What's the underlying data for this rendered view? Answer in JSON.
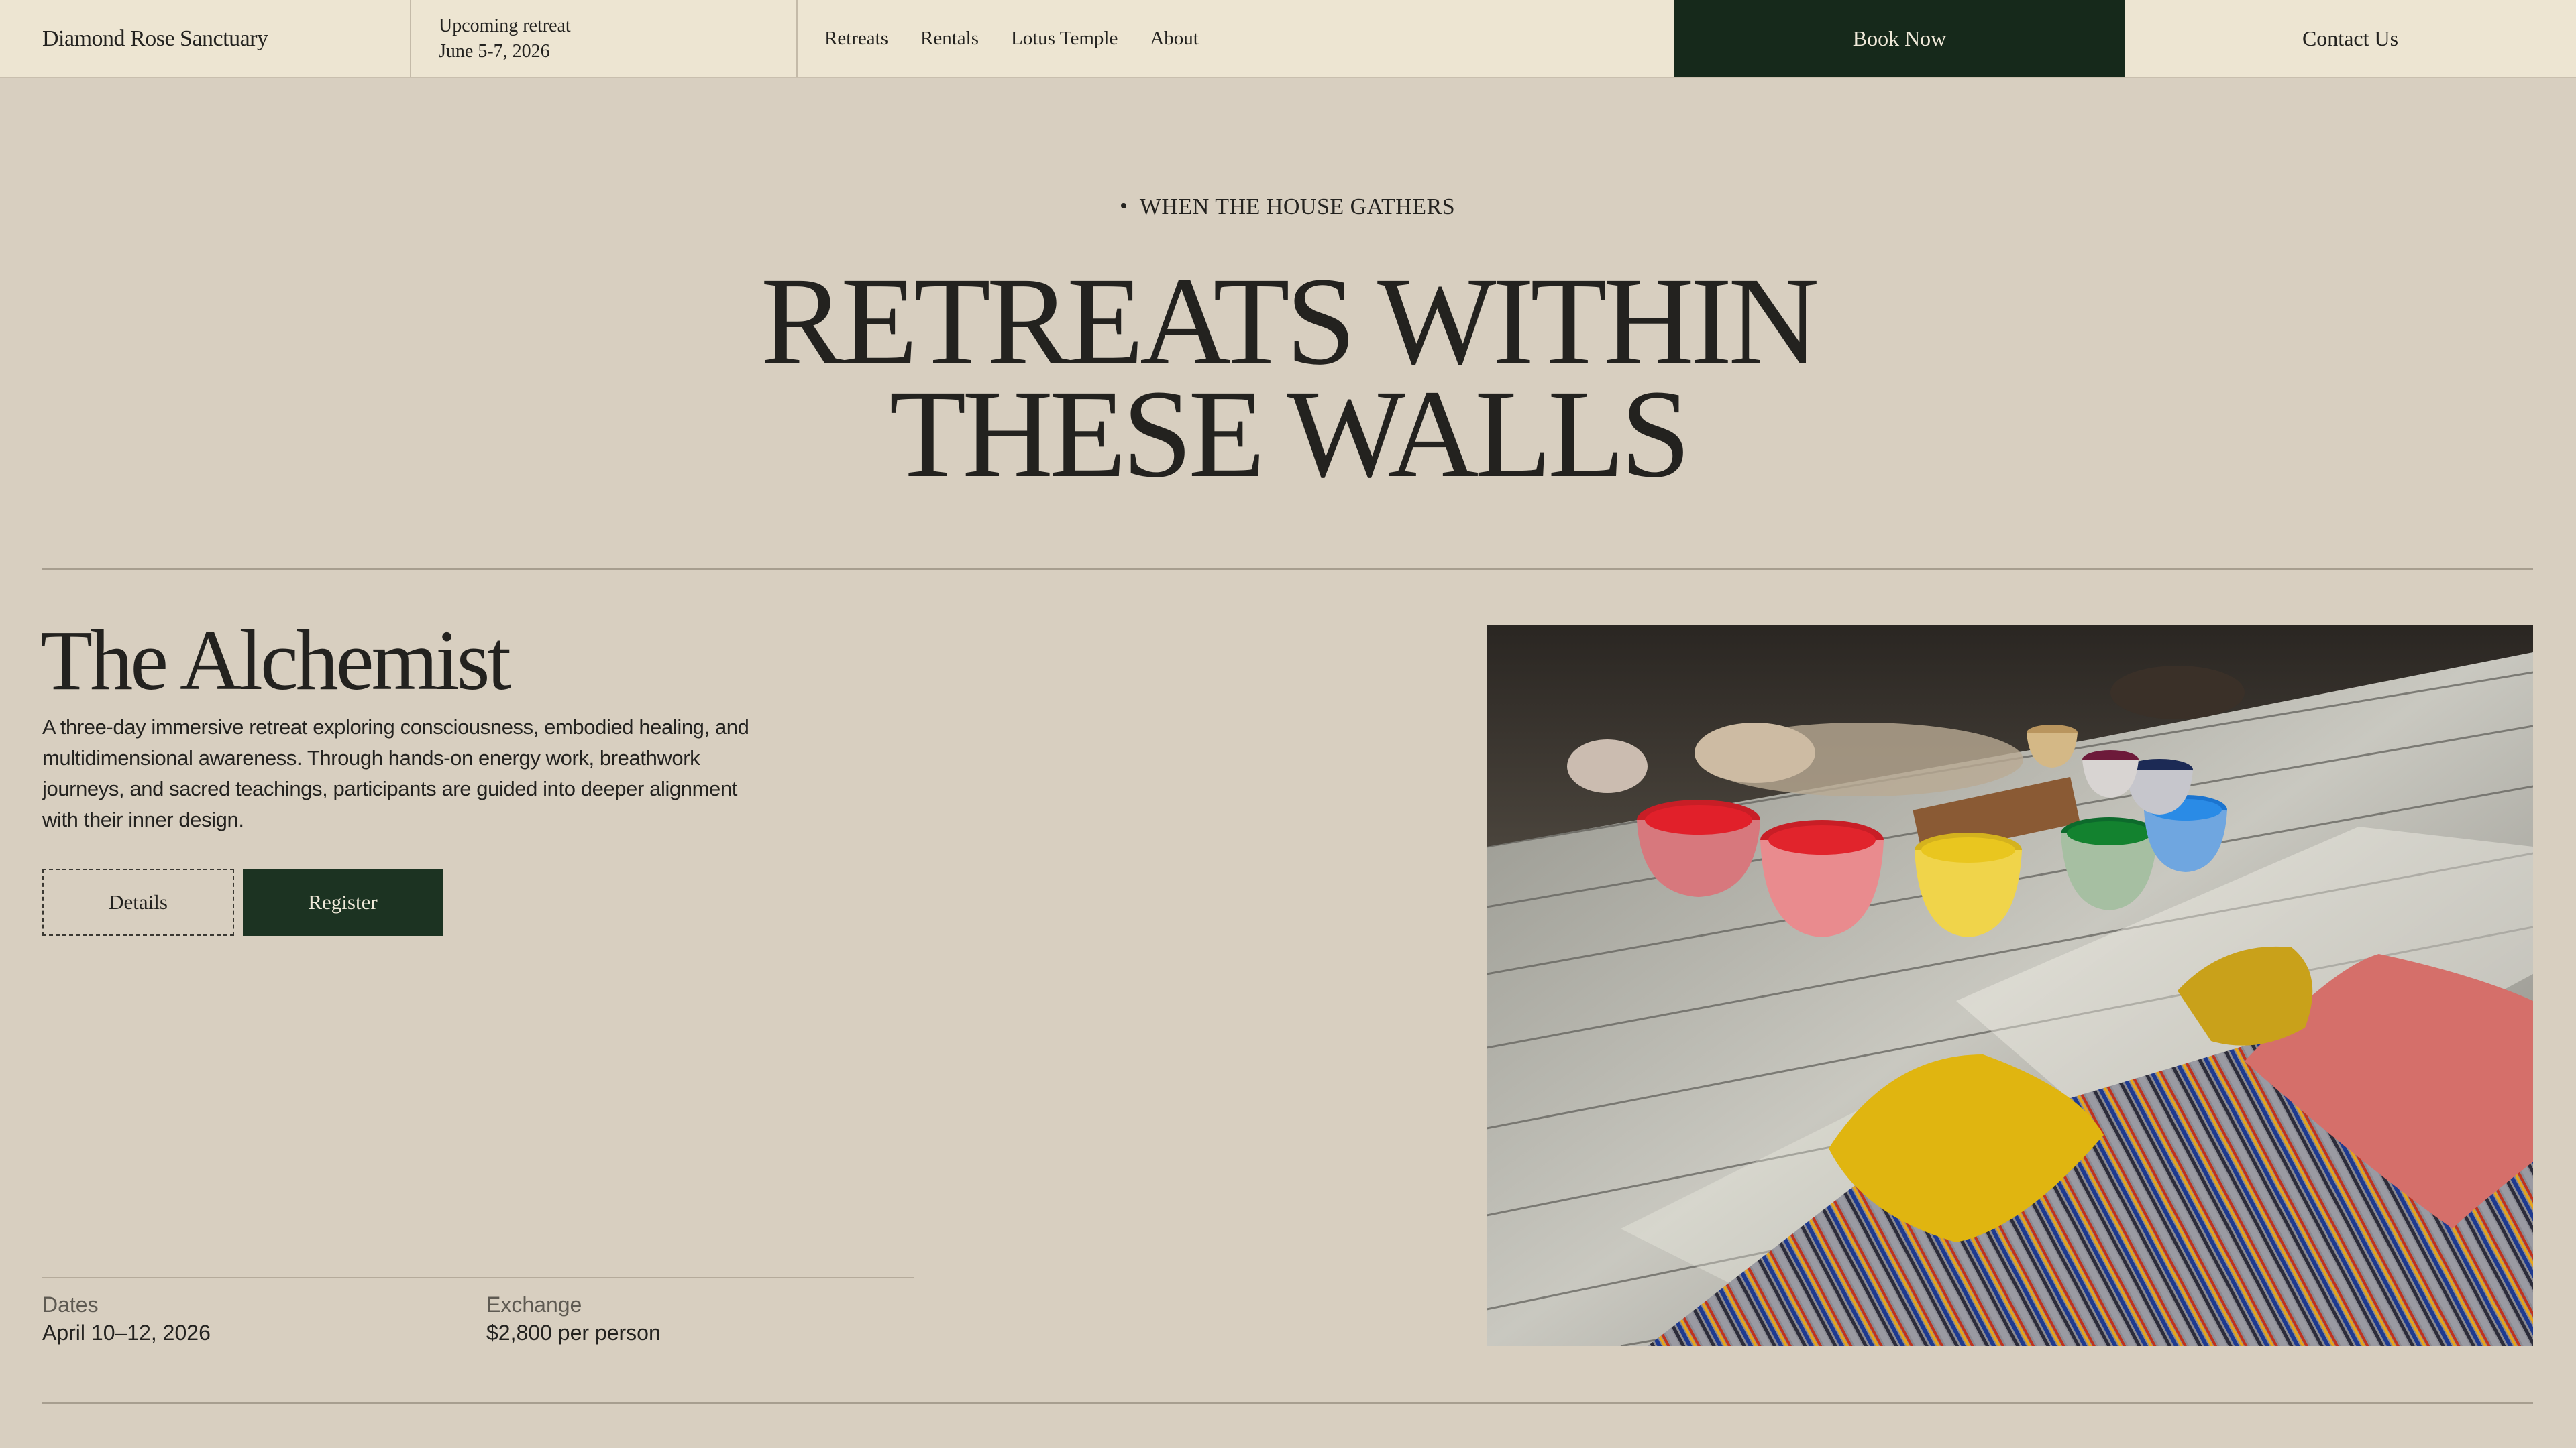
{
  "header": {
    "brand": "Diamond Rose Sanctuary",
    "upcoming_label": "Upcoming retreat",
    "upcoming_date": "June 5-7, 2026",
    "nav": [
      "Retreats",
      "Rentals",
      "Lotus Temple",
      "About"
    ],
    "book_label": "Book Now",
    "contact_label": "Contact Us"
  },
  "hero": {
    "eyebrow": "WHEN THE HOUSE GATHERS",
    "title_line1": "RETREATS WITHIN",
    "title_line2": "THESE WALLS"
  },
  "retreat": {
    "name": "The Alchemist",
    "description": "A three-day immersive retreat exploring consciousness, embodied healing, and multidimensional awareness. Through hands-on energy work, breathwork journeys, and sacred teachings, participants are guided into deeper alignment with their inner design.",
    "details_label": "Details",
    "register_label": "Register",
    "dates_label": "Dates",
    "dates_value": "April 10–12, 2026",
    "exchange_label": "Exchange",
    "exchange_value": "$2,800 per person"
  },
  "colors": {
    "background": "#d8cfc0",
    "header_bg": "#ede5d2",
    "accent_green": "#16291b",
    "text": "#23221f"
  }
}
